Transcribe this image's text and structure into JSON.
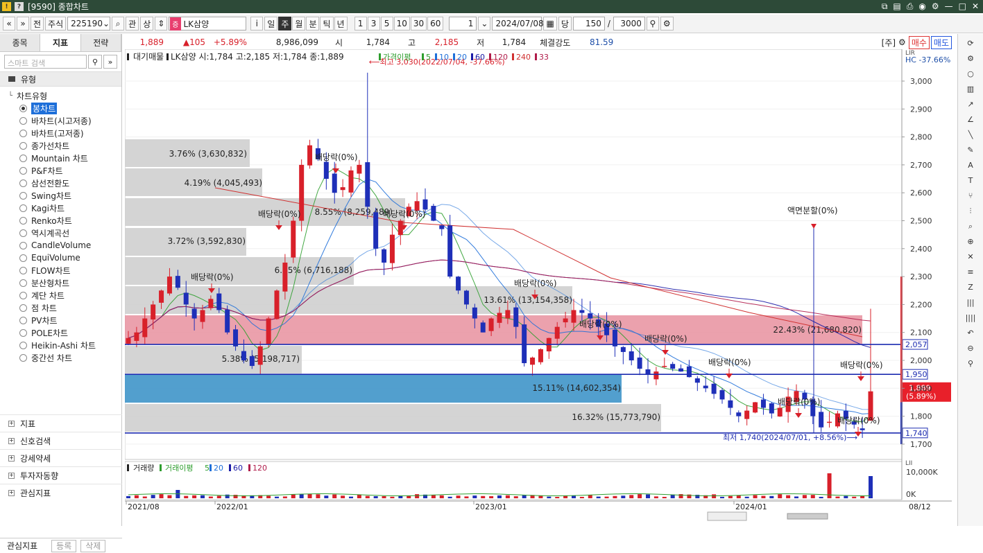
{
  "window": {
    "title": "[9590] 종합차트"
  },
  "toolbar": {
    "market": "주식",
    "code": "225190",
    "btn_gwan": "관",
    "btn_sang": "상",
    "stock_name": "LK삼양",
    "stock_market_mark": "증",
    "info": "i",
    "periods": [
      "일",
      "주",
      "월",
      "분",
      "틱",
      "년"
    ],
    "active_period": "주",
    "intervals": [
      "1",
      "3",
      "5",
      "10",
      "30",
      "60"
    ],
    "interval_value": "1",
    "date": "2024/07/08",
    "date_btn": "당",
    "count": "150",
    "slash": "/",
    "total": "3000",
    "nav_left": "«",
    "nav_down": "»",
    "prev": "전"
  },
  "left_panel": {
    "tabs": [
      "종목",
      "지표",
      "전략"
    ],
    "active_tab": "지표",
    "search_placeholder": "스마트 검색",
    "group_type": "유형",
    "tree_root": "차트유형",
    "chart_types": [
      "봉차트",
      "바차트(시고저종)",
      "바차트(고저종)",
      "종가선차트",
      "Mountain 차트",
      "P&F차트",
      "삼선전환도",
      "Swing차트",
      "Kagi차트",
      "Renko차트",
      "역시계곡선",
      "CandleVolume",
      "EquiVolume",
      "FLOW차트",
      "분산형차트",
      "계단 차트",
      "점 차트",
      "PV차트",
      "POLE차트",
      "Heikin-Ashi 차트",
      "중간선 차트"
    ],
    "selected_type": "봉차트",
    "groups": [
      "지표",
      "신호검색",
      "강세약세",
      "투자자동향",
      "관심지표"
    ],
    "fav_label": "관심지표",
    "fav_register": "등록",
    "fav_delete": "삭제"
  },
  "quote": {
    "price": "1,889",
    "change": "▲105",
    "change_pct": "+5.89%",
    "volume": "8,986,099",
    "open_label": "시",
    "open": "1,784",
    "high_label": "고",
    "high": "2,185",
    "low_label": "저",
    "low": "1,784",
    "strength_label": "체결강도",
    "strength": "81.59",
    "stock_tag": "[주]",
    "buy": "매수",
    "sell": "매도"
  },
  "chart": {
    "legend_title": "대기매물",
    "ohlc_line": "LK삼양 시:1,784 고:2,185 저:1,784 종:1,889",
    "ma_label": "가격이평",
    "ma_periods": [
      "5",
      "10",
      "20",
      "60",
      "120",
      "240",
      "33"
    ],
    "ma_colors": [
      "#2e9e2e",
      "#1e6fd9",
      "#1e6fd9",
      "#1a1aa6",
      "#b01b4a",
      "#d03030",
      "#b01b4a"
    ],
    "high_note": "최고 3,030(2022/07/04, -37.66%)",
    "low_note": "최저 1,740(2024/07/01, +8.56%)",
    "hc_note": "HC -37.66%",
    "split_note": "액면분할(0%)",
    "dividend_label": "배당락(0%)",
    "profile_labels": [
      "3.76% (3,630,832)",
      "4.19% (4,045,493)",
      "8.55% (8,259,489)",
      "3.72% (3,592,830)",
      "6.95% (6,716,188)",
      "13.61% (13,154,358)",
      "22.43% (21,680,820)",
      "5.38% (5,198,717)",
      "15.11% (14,602,354)",
      "16.32% (15,773,790)"
    ],
    "price_ticks": [
      "3,000",
      "2,900",
      "2,800",
      "2,700",
      "2,600",
      "2,500",
      "2,400",
      "2,300",
      "2,200",
      "2,100",
      "2,000",
      "1,900",
      "1,800",
      "1,700"
    ],
    "level_2057": "2,057",
    "level_1950": "1,950",
    "level_1740": "1,740",
    "current_price": "1,889",
    "current_pct": "(5.89%)",
    "x_labels": [
      "2021/08",
      "2022/01",
      "2023/01",
      "2024/01"
    ],
    "x_right_label": "08/12"
  },
  "volume_panel": {
    "title": "거래량",
    "ma_label": "거래이평",
    "ma_periods": [
      "5",
      "20",
      "60",
      "120"
    ],
    "ticks": [
      "10,000K",
      "0K"
    ]
  },
  "chart_data": {
    "type": "candlestick",
    "title": "LK삼양",
    "period": "weekly",
    "ylim": [
      1700,
      3050
    ],
    "ohlc_last": {
      "open": 1784,
      "high": 2185,
      "low": 1784,
      "close": 1889
    },
    "all_time_high": {
      "value": 3030,
      "date": "2022/07/04"
    },
    "all_time_low": {
      "value": 1740,
      "date": "2024/07/01"
    },
    "support_resistance": [
      2057,
      1950,
      1740
    ],
    "x_axis_labels": [
      "2021/08",
      "2022/01",
      "2023/01",
      "2024/01"
    ],
    "y_axis_labels": [
      "3,000",
      "2,900",
      "2,800",
      "2,700",
      "2,600",
      "2,500",
      "2,400",
      "2,300",
      "2,200",
      "2,100",
      "2,000",
      "1,900",
      "1,800",
      "1,700"
    ],
    "volume_profile_pct": [
      3.76,
      4.19,
      8.55,
      3.72,
      6.95,
      13.61,
      22.43,
      5.38,
      15.11,
      16.32
    ],
    "volume_profile_vol": [
      3630832,
      4045493,
      8259489,
      3592830,
      6716188,
      13154358,
      21680820,
      5198717,
      14602354,
      15773790
    ],
    "closes_approx": [
      2080,
      2100,
      2150,
      2200,
      2250,
      2300,
      2260,
      2200,
      2150,
      2180,
      2220,
      2180,
      2100,
      2050,
      2000,
      1980,
      2050,
      2150,
      2250,
      2350,
      2500,
      2700,
      2770,
      2720,
      2650,
      2600,
      2620,
      2680,
      2700,
      2550,
      2400,
      2350,
      2450,
      2500,
      2550,
      2570,
      2540,
      2500,
      2470,
      2300,
      2250,
      2200,
      2150,
      2100,
      2150,
      2170,
      2180,
      2120,
      1990,
      2010,
      2040,
      2080,
      2120,
      2150,
      2180,
      2170,
      2150,
      2120,
      2090,
      2050,
      2030,
      2000,
      1970,
      1950,
      1960,
      1980,
      1970,
      1960,
      1940,
      1920,
      1900,
      1880,
      1860,
      1830,
      1800,
      1820,
      1850,
      1830,
      1810,
      1830,
      1870,
      1890,
      1860,
      1800,
      1760,
      1780,
      1810,
      1790,
      1770,
      1750,
      1889
    ]
  }
}
